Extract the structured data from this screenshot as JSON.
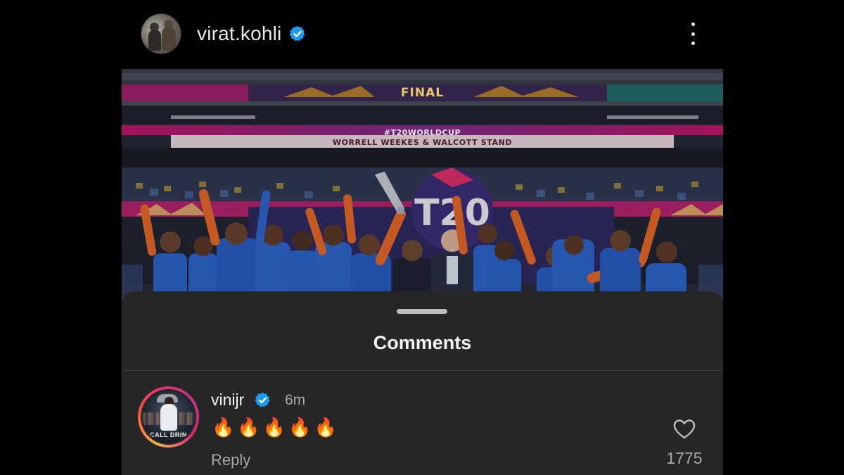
{
  "post": {
    "username": "virat.kohli",
    "verified": true,
    "image": {
      "description_icon": "team-celebration-photo",
      "banner_text": "FINAL",
      "hashtag_text": "#T20WORLDCUP",
      "stand_text": "WORRELL WEEKES & WALCOTT STAND"
    }
  },
  "comments_sheet": {
    "title": "Comments",
    "comments": [
      {
        "username": "vinijr",
        "verified": true,
        "time": "6m",
        "text": "🔥🔥🔥🔥🔥",
        "reply_label": "Reply",
        "like_count": "1775",
        "avatar_caption": "CALL DRIN"
      }
    ]
  },
  "colors": {
    "background": "#000000",
    "sheet": "#262626",
    "verified_blue": "#1d9bf0",
    "muted_text": "#a8a8a8"
  },
  "icons": [
    "verified-badge-icon",
    "more-options-icon",
    "heart-icon",
    "fire-emoji-icon"
  ]
}
